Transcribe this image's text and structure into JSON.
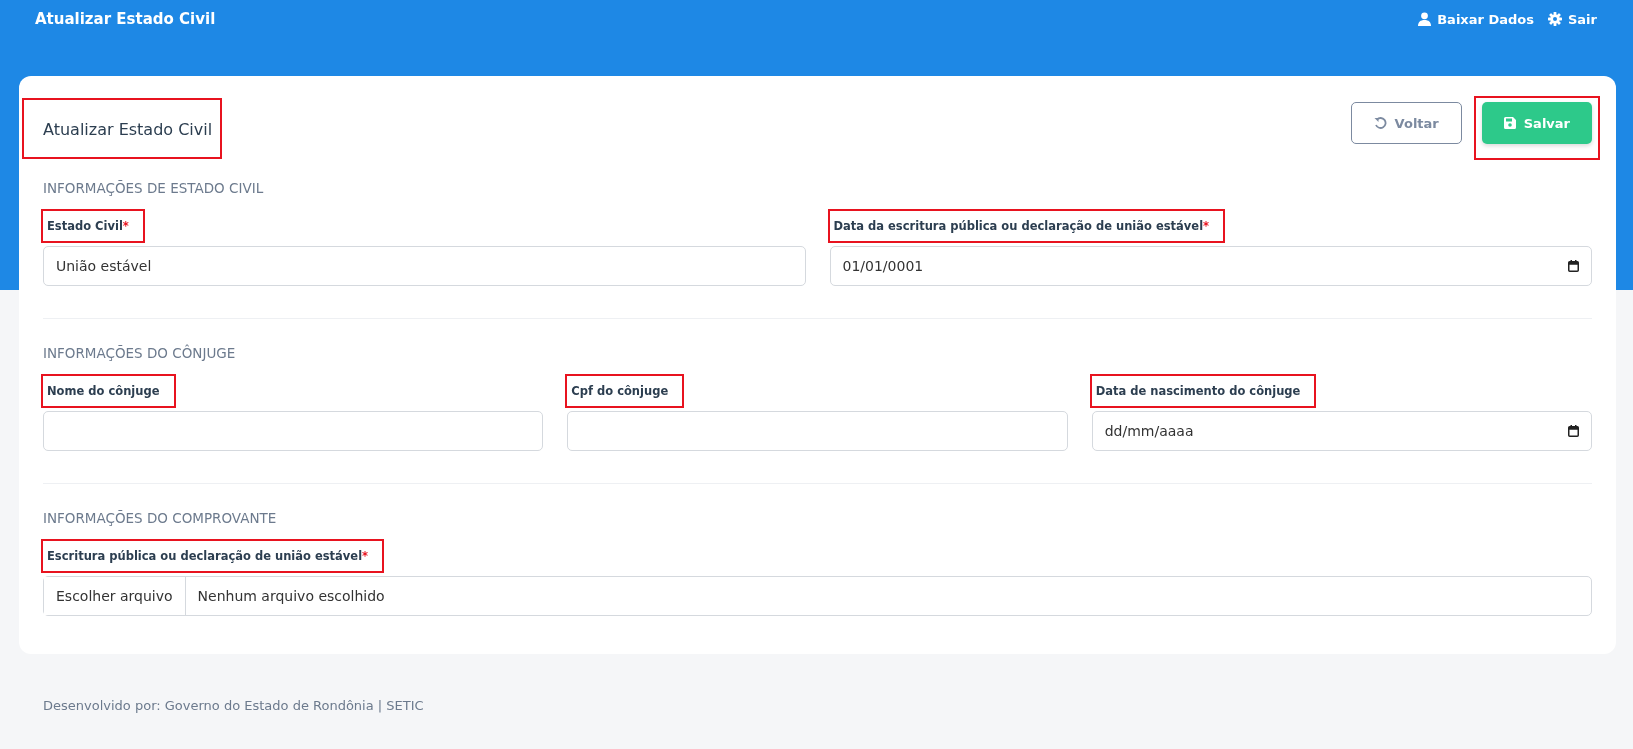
{
  "topbar": {
    "title": "Atualizar Estado Civil",
    "actions": [
      {
        "kind": "user",
        "label": "Baixar Dados"
      },
      {
        "kind": "gear",
        "label": "Sair"
      }
    ]
  },
  "card": {
    "title": "Atualizar Estado Civil",
    "title_highlighted": true,
    "buttons": [
      {
        "kind": "back",
        "label": "Voltar",
        "highlighted": false
      },
      {
        "kind": "save",
        "label": "Salvar",
        "highlighted": true
      }
    ],
    "sections": [
      {
        "heading": "INFORMAÇÕES DE ESTADO CIVIL",
        "fields": [
          {
            "kind": "text",
            "label": "Estado Civil",
            "required_mark": "*",
            "highlighted": true,
            "value": "União estável"
          },
          {
            "kind": "date",
            "label": "Data da escritura pública ou declaração de união estável",
            "required_mark": "*",
            "highlighted": true,
            "value": "01/01/0001"
          }
        ]
      },
      {
        "heading": "INFORMAÇÕES DO CÔNJUGE",
        "fields": [
          {
            "kind": "text",
            "label": "Nome do cônjuge",
            "highlighted": true
          },
          {
            "kind": "text",
            "label": "Cpf do cônjuge",
            "highlighted": true
          },
          {
            "kind": "date",
            "label": "Data de nascimento do cônjuge",
            "highlighted": true,
            "placeholder": "dd/mm/aaaa"
          }
        ]
      },
      {
        "heading": "INFORMAÇÕES DO COMPROVANTE",
        "fields": [
          {
            "kind": "file",
            "label": "Escritura pública ou declaração de união estável",
            "required_mark": "*",
            "highlighted": true,
            "button": "Escolher arquivo",
            "status": "Nenhum arquivo escolhido"
          }
        ]
      }
    ]
  },
  "footer": "Desenvolvido por: Governo do Estado de Rondônia | SETIC"
}
